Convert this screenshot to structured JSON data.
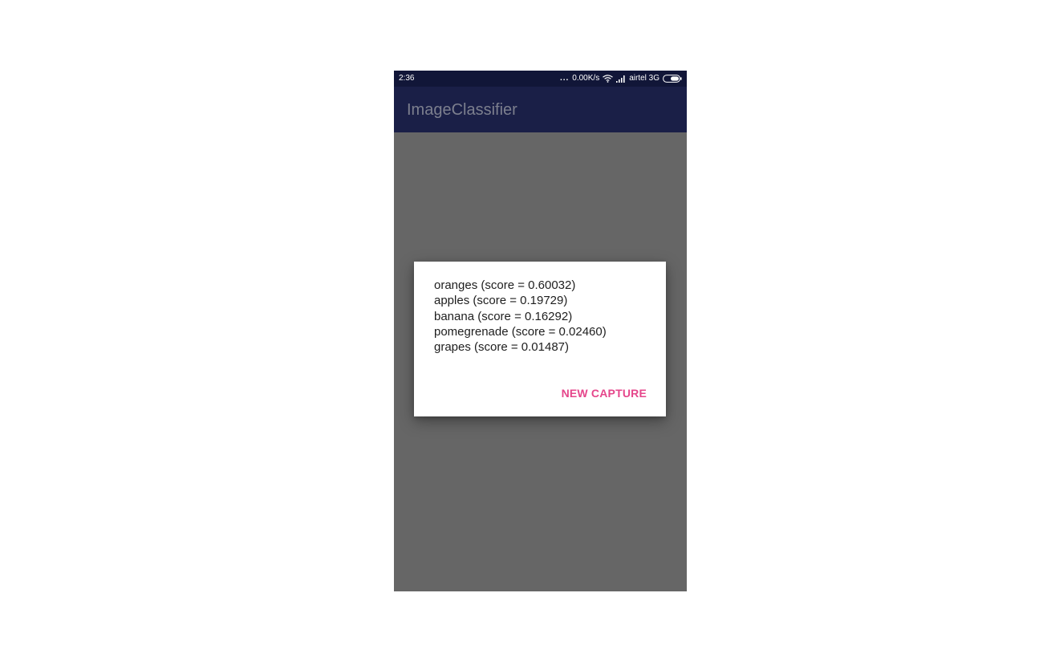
{
  "status_bar": {
    "time": "2:36",
    "dots": "...",
    "speed": "0.00K/s",
    "carrier": "airtel 3G",
    "icons": [
      "wifi-icon",
      "signal-icon",
      "battery-icon"
    ]
  },
  "app_bar": {
    "title": "ImageClassifier"
  },
  "dialog": {
    "results": [
      "oranges (score = 0.60032)",
      "apples (score = 0.19729)",
      "banana (score = 0.16292)",
      "pomegrenade (score = 0.02460)",
      "grapes (score = 0.01487)"
    ],
    "button_label": "NEW CAPTURE"
  },
  "colors": {
    "status_bar": "#111638",
    "app_bar": "#1a1f47",
    "scrim": "#666666",
    "accent": "#e5468b"
  }
}
